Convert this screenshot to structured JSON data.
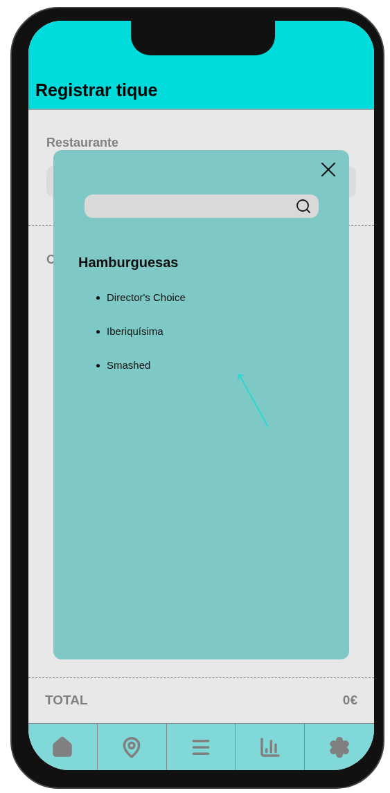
{
  "header": {
    "title": "Registrar tique"
  },
  "form": {
    "restaurant_label": "Restaurante",
    "second_label": "C"
  },
  "total": {
    "label": "TOTAL",
    "value": "0€"
  },
  "modal": {
    "category": "Hamburguesas",
    "items": [
      "Director's Choice",
      "Iberiquísima",
      "Smashed"
    ]
  }
}
